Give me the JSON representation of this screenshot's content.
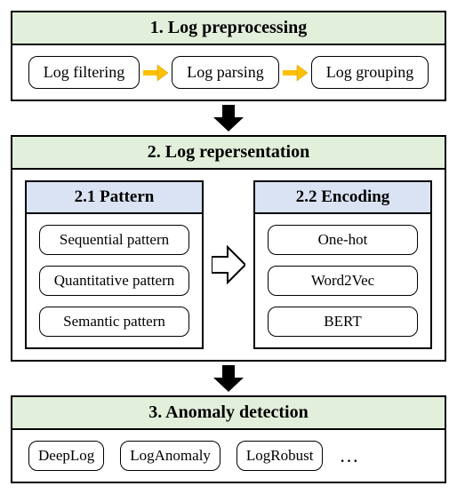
{
  "stage1": {
    "title": "1. Log preprocessing",
    "steps": [
      "Log filtering",
      "Log parsing",
      "Log grouping"
    ]
  },
  "stage2": {
    "title": "2. Log repersentation",
    "pattern": {
      "title": "2.1 Pattern",
      "items": [
        "Sequential pattern",
        "Quantitative pattern",
        "Semantic pattern"
      ]
    },
    "encoding": {
      "title": "2.2 Encoding",
      "items": [
        "One-hot",
        "Word2Vec",
        "BERT"
      ]
    }
  },
  "stage3": {
    "title": "3. Anomaly detection",
    "items": [
      "DeepLog",
      "LogAnomaly",
      "LogRobust"
    ],
    "more": "…"
  }
}
